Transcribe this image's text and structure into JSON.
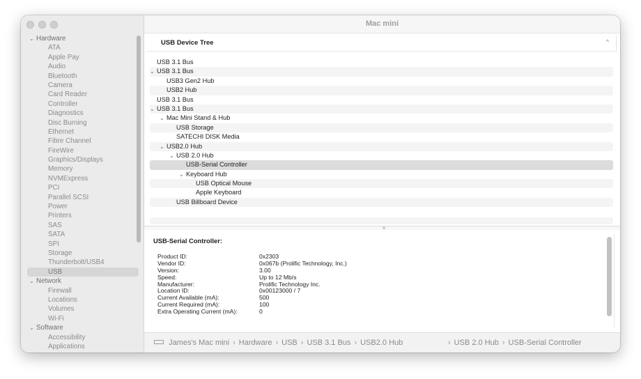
{
  "window": {
    "title": "Mac mini"
  },
  "sidebar": {
    "groups": [
      {
        "label": "Hardware",
        "expanded": true,
        "items": [
          "ATA",
          "Apple Pay",
          "Audio",
          "Bluetooth",
          "Camera",
          "Card Reader",
          "Controller",
          "Diagnostics",
          "Disc Burning",
          "Ethernet",
          "Fibre Channel",
          "FireWire",
          "Graphics/Displays",
          "Memory",
          "NVMExpress",
          "PCI",
          "Parallel SCSI",
          "Power",
          "Printers",
          "SAS",
          "SATA",
          "SPI",
          "Storage",
          "Thunderbolt/USB4",
          "USB"
        ]
      },
      {
        "label": "Network",
        "expanded": true,
        "items": [
          "Firewall",
          "Locations",
          "Volumes",
          "Wi-Fi"
        ]
      },
      {
        "label": "Software",
        "expanded": true,
        "items": [
          "Accessibility",
          "Applications"
        ]
      }
    ],
    "selected": "USB"
  },
  "tree": {
    "header": "USB Device Tree",
    "rows": [
      {
        "label": "USB 3.1 Bus",
        "level": 0,
        "expandable": false
      },
      {
        "label": "USB 3.1 Bus",
        "level": 0,
        "expandable": true
      },
      {
        "label": "USB3 Gen2 Hub",
        "level": 1,
        "expandable": false
      },
      {
        "label": "USB2 Hub",
        "level": 1,
        "expandable": false
      },
      {
        "label": "USB 3.1 Bus",
        "level": 0,
        "expandable": false
      },
      {
        "label": "USB 3.1 Bus",
        "level": 0,
        "expandable": true
      },
      {
        "label": "Mac Mini Stand & Hub",
        "level": 1,
        "expandable": true
      },
      {
        "label": "USB Storage",
        "level": 2,
        "expandable": false
      },
      {
        "label": "SATECHI DISK Media",
        "level": 2,
        "expandable": false
      },
      {
        "label": "USB2.0 Hub",
        "level": 1,
        "expandable": true
      },
      {
        "label": "USB 2.0 Hub",
        "level": 2,
        "expandable": true
      },
      {
        "label": "USB-Serial Controller",
        "level": 3,
        "expandable": false,
        "selected": true
      },
      {
        "label": "Keyboard Hub",
        "level": 3,
        "expandable": true
      },
      {
        "label": "USB Optical Mouse",
        "level": 4,
        "expandable": false
      },
      {
        "label": "Apple Keyboard",
        "level": 4,
        "expandable": false
      },
      {
        "label": "USB Billboard Device",
        "level": 2,
        "expandable": false
      }
    ]
  },
  "detail": {
    "title": "USB-Serial Controller:",
    "properties": [
      {
        "key": "Product ID:",
        "value": "0x2303"
      },
      {
        "key": "Vendor ID:",
        "value": "0x067b  (Prolific Technology, Inc.)"
      },
      {
        "key": "Version:",
        "value": "3.00"
      },
      {
        "key": "Speed:",
        "value": "Up to 12 Mb/s"
      },
      {
        "key": "Manufacturer:",
        "value": "Prolific Technology Inc."
      },
      {
        "key": "Location ID:",
        "value": "0x00123000 / 7"
      },
      {
        "key": "Current Available (mA):",
        "value": "500"
      },
      {
        "key": "Current Required (mA):",
        "value": "100"
      },
      {
        "key": "Extra Operating Current (mA):",
        "value": "0"
      }
    ]
  },
  "breadcrumbs": {
    "left": [
      "James's Mac mini",
      "Hardware",
      "USB",
      "USB 3.1 Bus",
      "USB2.0 Hub"
    ],
    "right": [
      "USB 2.0 Hub",
      "USB-Serial Controller"
    ],
    "icon": "mac-mini-icon"
  }
}
